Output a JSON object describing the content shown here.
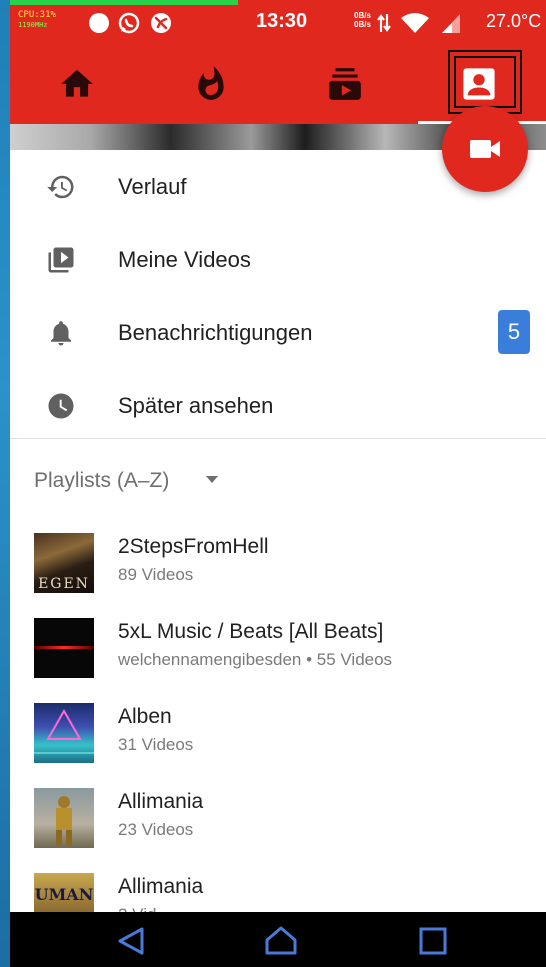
{
  "status_bar": {
    "cpu": "CPU:31%",
    "cpu_freq": "1190MHz",
    "time": "13:30",
    "net_up": "0B/s",
    "net_down": "0B/s",
    "temperature": "27.0°C",
    "icons": [
      "circle-notification-icon",
      "whatsapp-icon",
      "blocked-icon",
      "data-arrows-icon",
      "wifi-icon",
      "signal-icon"
    ]
  },
  "tabs": [
    {
      "name": "home-icon",
      "active": false
    },
    {
      "name": "trending-flame-icon",
      "active": false
    },
    {
      "name": "subscriptions-icon",
      "active": false
    },
    {
      "name": "account-icon",
      "active": true
    }
  ],
  "fab": {
    "icon": "videocam-icon"
  },
  "library": {
    "items": [
      {
        "label": "Verlauf",
        "icon": "history-icon"
      },
      {
        "label": "Meine Videos",
        "icon": "my-videos-icon"
      },
      {
        "label": "Benachrichtigungen",
        "icon": "bell-icon",
        "badge": "5"
      },
      {
        "label": "Später ansehen",
        "icon": "watch-later-icon"
      }
    ]
  },
  "playlists": {
    "header": "Playlists (A–Z)",
    "items": [
      {
        "title": "2StepsFromHell",
        "subtitle": "89 Videos",
        "thumb_text": "EGEN"
      },
      {
        "title": "5xL Music / Beats [All Beats]",
        "subtitle": "welchennamengibesden • 55 Videos"
      },
      {
        "title": "Alben",
        "subtitle": "31 Videos"
      },
      {
        "title": "Allimania",
        "subtitle": "23 Videos"
      },
      {
        "title": "Allimania",
        "subtitle": "2 Vid",
        "thumb_text": "UMAN"
      }
    ]
  },
  "nav": {
    "back": "back-icon",
    "home": "home-nav-icon",
    "recents": "recents-icon"
  },
  "colors": {
    "brand_red": "#e0281f",
    "badge_blue": "#3b7ddb"
  }
}
